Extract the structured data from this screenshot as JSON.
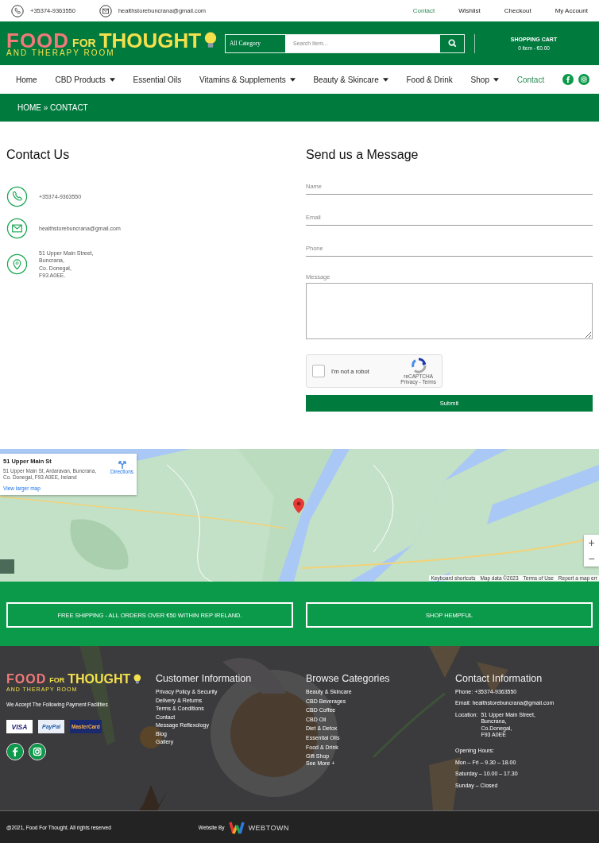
{
  "top_bar": {
    "phone": "+35374-9363550",
    "email": "healthstorebuncrana@gmail.com",
    "links": [
      {
        "label": "Contact",
        "selected": true
      },
      {
        "label": "Wishlist",
        "selected": false
      },
      {
        "label": "Checkout",
        "selected": false
      },
      {
        "label": "My Account",
        "selected": false
      }
    ]
  },
  "header": {
    "logo": {
      "words": [
        "FOOD",
        "FOR",
        "THOUGHT"
      ],
      "subtitle": "AND THERAPY ROOM"
    },
    "search": {
      "category": "All Category",
      "placeholder": "Search Item..."
    },
    "cart": {
      "title": "SHOPPING CART",
      "summary": "0 item - €0.00"
    }
  },
  "nav": [
    {
      "label": "Home",
      "selected": false,
      "dropdown": false
    },
    {
      "label": "CBD Products",
      "selected": false,
      "dropdown": true
    },
    {
      "label": "Essential Oils",
      "selected": false,
      "dropdown": false
    },
    {
      "label": "Vitamins & Supplements",
      "selected": false,
      "dropdown": true
    },
    {
      "label": "Beauty & Skincare",
      "selected": false,
      "dropdown": true
    },
    {
      "label": "Food & Drink",
      "selected": false,
      "dropdown": false
    },
    {
      "label": "Shop",
      "selected": false,
      "dropdown": true
    },
    {
      "label": "Contact",
      "selected": true,
      "dropdown": false
    }
  ],
  "breadcrumb": "HOME » CONTACT",
  "contact": {
    "title": "Contact Us",
    "items": [
      {
        "kind": "phone",
        "lines": [
          "+35374-9363550"
        ]
      },
      {
        "kind": "email",
        "lines": [
          "healthstorebuncrana@gmail.com"
        ]
      },
      {
        "kind": "location",
        "lines": [
          "51 Upper Main Street,",
          "Buncrana,",
          "Co. Donegal,",
          "F93 A0EE."
        ]
      }
    ]
  },
  "form": {
    "title": "Send us a Message",
    "fields": [
      {
        "kind": "line",
        "placeholder": "Name"
      },
      {
        "kind": "line",
        "placeholder": "Email"
      },
      {
        "kind": "line",
        "placeholder": "Phone"
      },
      {
        "kind": "area",
        "label": "Message"
      }
    ],
    "captcha": {
      "label": "I'm not a robot",
      "checked": false,
      "brand": "reCAPTCHA",
      "links": "Privacy - Terms"
    },
    "submit": "Submit"
  },
  "map": {
    "kind": "picture",
    "card": {
      "title": "51 Upper Main St",
      "address": "51 Upper Main St, Ardaravan, Buncrana, Co. Donegal, F93 A0EE, Ireland",
      "directions": "Directions",
      "link": "View larger map"
    },
    "zoom": [
      "+",
      "−"
    ],
    "attribution": [
      "Keyboard shortcuts",
      "Map data ©2023",
      "Terms of Use",
      "Report a map err"
    ]
  },
  "banners": [
    "FREE SHIPPING - ALL ORDERS OVER €50 WITHIN REP IRELAND.",
    "SHOP HEMPFUL"
  ],
  "footer": {
    "logo": {
      "words": [
        "FOOD",
        "FOR",
        "THOUGHT"
      ],
      "subtitle": "AND THERAPY ROOM"
    },
    "payments_text": "We Accept The Following Payment Facilities",
    "payments": [
      "VISA",
      "PayPal",
      "MasterCard"
    ],
    "customer": {
      "title": "Customer Information",
      "links": [
        "Privacy Policy & Security",
        "Delivery & Returns",
        "Terms & Conditions",
        "Contact",
        "Message Reflexology",
        "Blog",
        "Gallery"
      ]
    },
    "categories": {
      "title": "Browse Categories",
      "links": [
        "Beauty & Skincare",
        "CBD Beverages",
        "CBD Coffee",
        "CBD Oil",
        "Diet & Detox",
        "Essential Oils",
        "Food & Drink",
        "Gift Shop"
      ],
      "more": "See More +"
    },
    "contact": {
      "title": "Contact Information",
      "phone": "Phone: +35374-9363550",
      "email": "Email: healthstorebuncrana@gmail.com",
      "location_label": "Location:",
      "location": [
        "51 Upper Main Street,",
        "Buncrana,",
        "Co.Donegal,",
        "F93 A0EE"
      ],
      "hours_title": "Opening Hours:",
      "hours": [
        "Mon – Fri – 9.30 – 18.00",
        "Saturday – 10.00 – 17.30",
        "Sunday – Closed"
      ]
    }
  },
  "bottom_bar": {
    "copyright": "@2021, Food For Thought. All rights reserved",
    "credit": "Website By",
    "brand": "WEBTOWN"
  }
}
